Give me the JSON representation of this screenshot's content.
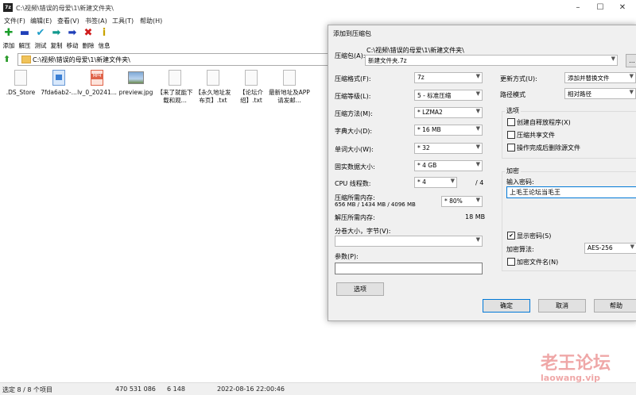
{
  "window": {
    "title": "C:\\视频\\错误的母爱\\1\\新建文件夹\\",
    "app_icon": "7z"
  },
  "menu": [
    "文件(F)",
    "编辑(E)",
    "查看(V)",
    "书签(A)",
    "工具(T)",
    "帮助(H)"
  ],
  "toolbar": [
    {
      "label": "添加",
      "icon": "plus-icon",
      "glyph": "✚",
      "color": "#1a9e2a"
    },
    {
      "label": "解压",
      "icon": "minus-icon",
      "glyph": "▬",
      "color": "#1f3fb8"
    },
    {
      "label": "测试",
      "icon": "check-icon",
      "glyph": "✔",
      "color": "#1f9ec9"
    },
    {
      "label": "复制",
      "icon": "copy-arrow-icon",
      "glyph": "➡",
      "color": "#11998e"
    },
    {
      "label": "移动",
      "icon": "move-arrow-icon",
      "glyph": "➡",
      "color": "#1f3fb8"
    },
    {
      "label": "删除",
      "icon": "delete-x-icon",
      "glyph": "✖",
      "color": "#d01c1c"
    },
    {
      "label": "信息",
      "icon": "info-icon",
      "glyph": "i",
      "color": "#c9a300"
    }
  ],
  "address": {
    "path": "C:\\视频\\错误的母爱\\1\\新建文件夹\\"
  },
  "files": [
    {
      "name": ".DS_Store",
      "type": "doc"
    },
    {
      "name": "7fda6ab2-...",
      "type": "image"
    },
    {
      "name": "lv_0_20241...",
      "type": "mp4",
      "badge": "MP4"
    },
    {
      "name": "preview.jpg",
      "type": "jpg"
    },
    {
      "name": "【来了就能下载和观...",
      "type": "doc"
    },
    {
      "name": "【永久地址发布页】.txt",
      "type": "doc"
    },
    {
      "name": "【论坛介绍】.txt",
      "type": "doc"
    },
    {
      "name": "最新地址及APP请发邮...",
      "type": "doc"
    }
  ],
  "status": {
    "selected": "选定 8 / 8 个项目",
    "size": "470 531 086",
    "packed": "6 148",
    "modified": "2022-08-16 22:00:46"
  },
  "dialog": {
    "title": "添加到压缩包",
    "archive_label": "压缩包(A):",
    "archive_dir": "C:\\视频\\错误的母爱\\1\\新建文件夹\\",
    "archive_name": "新建文件夹.7z",
    "browse": "...",
    "format_label": "压缩格式(F):",
    "format_value": "7z",
    "level_label": "压缩等级(L):",
    "level_value": "5 - 标准压缩",
    "method_label": "压缩方法(M):",
    "method_value": "* LZMA2",
    "dict_label": "字典大小(D):",
    "dict_value": "* 16 MB",
    "word_label": "单词大小(W):",
    "word_value": "* 32",
    "solid_label": "固实数据大小:",
    "solid_value": "* 4 GB",
    "cpu_label": "CPU 线程数:",
    "cpu_value": "* 4",
    "cpu_max": "/ 4",
    "mem_label": "压缩所需内存:",
    "mem_value": "656 MB / 1434 MB / 4096 MB",
    "mem_pct": "* 80%",
    "dmem_label": "解压所需内存:",
    "dmem_value": "18 MB",
    "split_label": "分卷大小，字节(V):",
    "params_label": "参数(P):",
    "options_btn": "选项",
    "update_label": "更新方式(U):",
    "update_value": "添加并替换文件",
    "path_label": "路径模式",
    "path_value": "相对路径",
    "opt_group": "选项",
    "sfx": "创建自释放程序(X)",
    "shared": "压缩共享文件",
    "delete_after": "操作完成后删除源文件",
    "enc_group": "加密",
    "pw_label": "输入密码:",
    "pw_value": "上毛王论坛当毛王",
    "show_pw": "显示密码(S)",
    "enc_method_label": "加密算法:",
    "enc_method_value": "AES-256",
    "enc_names": "加密文件名(N)",
    "ok": "确定",
    "cancel": "取消",
    "help": "帮助"
  },
  "watermark": {
    "cn": "老王论坛",
    "en": "laowang.vip"
  }
}
